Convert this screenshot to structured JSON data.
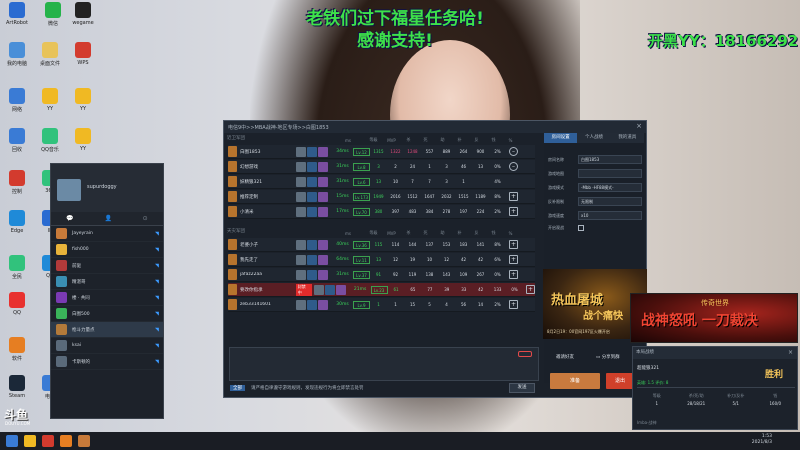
{
  "overlay": {
    "line1": "老铁们过下福星任务哈!",
    "line2": "感谢支持!",
    "contact": "开黑YY：18166292"
  },
  "desktop_icons": [
    {
      "label": "ArtRobot",
      "color": "#2a6bd1"
    },
    {
      "label": "微信",
      "color": "#25b34a"
    },
    {
      "label": "wegame",
      "color": "#222222"
    },
    {
      "label": "我的电脑",
      "color": "#4a8fd8"
    },
    {
      "label": "桌面文件",
      "color": "#e8c35a"
    },
    {
      "label": "WPS",
      "color": "#d33b2e"
    },
    {
      "label": "网络",
      "color": "#3a7bd5"
    },
    {
      "label": "YY",
      "color": "#f0b923"
    },
    {
      "label": "YY",
      "color": "#f0b923"
    },
    {
      "label": "回收",
      "color": "#3a7bd5"
    },
    {
      "label": "QQ音乐",
      "color": "#31c27c"
    },
    {
      "label": "YY",
      "color": "#f0b923"
    },
    {
      "label": "控制",
      "color": "#d33b2e"
    },
    {
      "label": "360",
      "color": "#31c27c"
    },
    {
      "label": "Edge",
      "color": "#1f8ad8"
    },
    {
      "label": "IE",
      "color": "#2a6bd1"
    },
    {
      "label": "全民",
      "color": "#31c27c"
    },
    {
      "label": "QQ",
      "color": "#1f8ad8"
    },
    {
      "label": "QQ",
      "color": "#e8312f"
    },
    {
      "label": "软件",
      "color": "#e67e22"
    },
    {
      "label": "Steam",
      "color": "#1b2838"
    },
    {
      "label": "电脑",
      "color": "#3a7bd5"
    }
  ],
  "side_panel": {
    "user_name": "supurdoggy",
    "tabs": [
      "💬",
      "👤",
      "⊙"
    ],
    "friends": [
      {
        "name": "Jayeyrain",
        "color": "#c77a3a"
      },
      {
        "name": "fish000",
        "color": "#e8b33a"
      },
      {
        "name": "前驱",
        "color": "#b33a3a"
      },
      {
        "name": "精湛哥",
        "color": "#3a8fb3"
      },
      {
        "name": "楼 · 共同",
        "color": "#7a3ab3"
      },
      {
        "name": "白图500",
        "color": "#3ab35a"
      },
      {
        "name": "枪斗力量点",
        "color": "#b37a3a"
      },
      {
        "name": "ksai",
        "color": "#5a6a7a"
      },
      {
        "name": "卡斯顿的",
        "color": "#5a6a7a"
      }
    ]
  },
  "game_window": {
    "title": "电信9中>>MBA战神-地区专场>>白图1853",
    "team1_label": "近卫军团",
    "team2_label": "天灾军团",
    "columns": [
      "",
      "ms",
      "",
      "等级",
      "MVP",
      "杀",
      "死",
      "助",
      "补",
      "反",
      "钱",
      "%",
      ""
    ],
    "team1": [
      {
        "name": "白图1853",
        "ping": "34ms",
        "level": "Lv.12",
        "stats": [
          "1315",
          "1322",
          "1248",
          "557",
          "889",
          "264",
          "900",
          "2%"
        ],
        "action": "–",
        "banned": false
      },
      {
        "name": "幻想游戏",
        "ping": "31ms",
        "level": "Lv.8",
        "stats": [
          "3",
          "2",
          "24",
          "1",
          "3",
          "46",
          "13",
          "0%"
        ],
        "action": "–",
        "banned": false
      },
      {
        "name": "妖精狼321",
        "ping": "31ms",
        "level": "Lv.6",
        "stats": [
          "13",
          "10",
          "7",
          "7",
          "3",
          "1",
          "",
          "4%"
        ],
        "action": "",
        "banned": false
      },
      {
        "name": "推荐定制",
        "ping": "15ms",
        "level": "Lv.173",
        "stats": [
          "1949",
          "2016",
          "1512",
          "1647",
          "2032",
          "1515",
          "1189",
          "8%"
        ],
        "action": "+",
        "banned": false
      },
      {
        "name": "小清米",
        "ping": "17ms",
        "level": "Lv.70",
        "stats": [
          "380",
          "397",
          "483",
          "384",
          "278",
          "197",
          "224",
          "2%"
        ],
        "action": "+",
        "banned": false
      }
    ],
    "team2": [
      {
        "name": "老婆小子",
        "ping": "40ms",
        "level": "Lv.36",
        "stats": [
          "115",
          "114",
          "144",
          "137",
          "153",
          "183",
          "141",
          "8%"
        ],
        "action": "+",
        "banned": false
      },
      {
        "name": "我先走了",
        "ping": "64ms",
        "level": "Lv.11",
        "stats": [
          "13",
          "12",
          "19",
          "10",
          "12",
          "42",
          "42",
          "6%"
        ],
        "action": "+",
        "banned": false
      },
      {
        "name": "jafaz22aa",
        "ping": "31ms",
        "level": "Lv.37",
        "stats": [
          "91",
          "92",
          "119",
          "138",
          "143",
          "109",
          "267",
          "0%"
        ],
        "action": "+",
        "banned": false
      },
      {
        "name": "要改你指承",
        "ping": "21ms",
        "level": "Lv.23",
        "stats": [
          "61",
          "65",
          "77",
          "39",
          "33",
          "42",
          "133",
          "0%"
        ],
        "action": "+",
        "banned": true,
        "ban_label": "封禁中"
      },
      {
        "name": "zeb33141601",
        "ping": "30ms",
        "level": "Lv.9",
        "stats": [
          "1",
          "1",
          "15",
          "5",
          "4",
          "56",
          "14",
          "2%"
        ],
        "action": "+",
        "banned": false
      }
    ],
    "right_panel": {
      "tabs": [
        "房间设置",
        "个人战绩",
        "我的道具"
      ],
      "fields": [
        {
          "label": "房间名称",
          "value": "白图1853"
        },
        {
          "label": "游戏地图",
          "value": ""
        },
        {
          "label": "游戏模式",
          "value": "-Mbb -HF88模式-"
        },
        {
          "label": "反补限制",
          "value": "无限制"
        },
        {
          "label": "游戏速度",
          "value": "x10"
        },
        {
          "label": "开启观战",
          "value": ""
        }
      ],
      "promo_title": "热血屠城",
      "promo_sub": "战个痛快",
      "promo_date": "8月2日19：00官网197区火爆开启",
      "invite_label": "邀请好友",
      "share_label": "分享到群",
      "ready_label": "准备",
      "exit_label": "退出"
    },
    "chat_placeholder": "",
    "chat_channel": "全部",
    "chat_hint": "请严格自律遵守游戏规则，发现违规行为将立即禁言处罚",
    "send_label": "发送"
  },
  "ad_banner": {
    "title": "战神怒吼 一刀裁决",
    "brand": "传奇世界"
  },
  "result_popup": {
    "header": "本局战绩",
    "name": "超能狼321",
    "result": "胜利",
    "sub": "英雄: 1.5  评价: 8",
    "columns": [
      "等级",
      "杀/死/助",
      "补刀/反补",
      "钱"
    ],
    "values": [
      "1",
      "28/18/21",
      "5/1",
      "160/0"
    ],
    "footer": "Imba-战神"
  },
  "taskbar": {
    "time": "1:53",
    "date": "2021/8/3"
  },
  "watermark": {
    "logo": "斗鱼",
    "url": "DOUYU.COM"
  }
}
